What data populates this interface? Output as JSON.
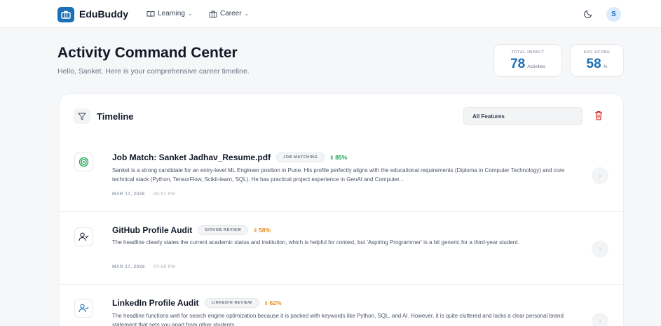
{
  "header": {
    "brand": "EduBuddy",
    "nav": [
      {
        "label": "Learning",
        "icon": "book-open-icon"
      },
      {
        "label": "Career",
        "icon": "briefcase-icon"
      }
    ],
    "avatar_initial": "S",
    "theme_icon": "moon-icon"
  },
  "page": {
    "title": "Activity Command Center",
    "subtitle": "Hello, Sanket. Here is your comprehensive career timeline."
  },
  "stats": [
    {
      "label": "TOTAL IMPACT",
      "value": "78",
      "unit": "Activities"
    },
    {
      "label": "AVG SCORE",
      "value": "58",
      "unit": "%"
    }
  ],
  "timeline": {
    "title": "Timeline",
    "filter_value": "All Features",
    "items": [
      {
        "title": "Job Match: Sanket Jadhav_Resume.pdf",
        "tag": "JOB MATCHING",
        "score": "85%",
        "score_color": "#16a34a",
        "icon": "target-icon",
        "icon_color": "#16a34a",
        "description": "Sanket is a strong candidate for an entry-level ML Engineer position in Pune. His profile perfectly aligns with the educational requirements (Diploma in Computer Technology) and core technical stack (Python, TensorFlow, Scikit-learn, SQL). He has practical project experience in GenAI and Computer...",
        "date": "MAR 17, 2026",
        "time": "08:01 PM"
      },
      {
        "title": "GitHub Profile Audit",
        "tag": "GITHUB REVIEW",
        "score": "58%",
        "score_color": "#ea8a1b",
        "icon": "user-check-icon",
        "icon_color": "#111827",
        "description": "The headline clearly states the current academic status and institution, which is helpful for context, but 'Aspiring Programmer' is a bit generic for a third-year student.",
        "date": "MAR 17, 2026",
        "time": "07:58 PM"
      },
      {
        "title": "LinkedIn Profile Audit",
        "tag": "LINKEDIN REVIEW",
        "score": "62%",
        "score_color": "#ea8a1b",
        "icon": "user-check-icon",
        "icon_color": "#1a6fb5",
        "description": "The headline functions well for search engine optimization because it is packed with keywords like Python, SQL, and AI. However, it is quite cluttered and lacks a clear personal brand statement that sets you apart from other students."
      }
    ]
  },
  "colors": {
    "brand": "#1a6fb5",
    "danger": "#dc2626"
  }
}
